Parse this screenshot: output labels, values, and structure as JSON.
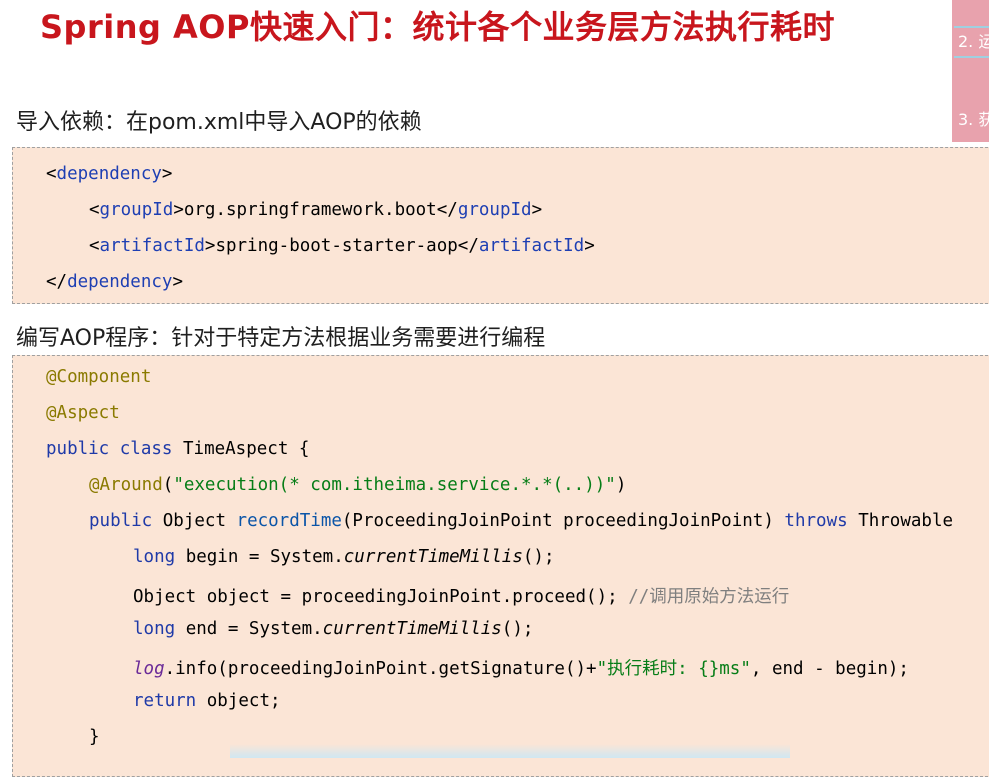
{
  "title": "Spring AOP快速入门：统计各个业务层方法执行耗时",
  "side_panel": {
    "item2": "2. 运",
    "item3": "3. 获"
  },
  "section1": {
    "heading": "导入依赖：在pom.xml中导入AOP的依赖",
    "code": {
      "open_tag": "dependency",
      "group_tag": "groupId",
      "group_value": "org.springframework.boot",
      "artifact_tag": "artifactId",
      "artifact_value": "spring-boot-starter-aop"
    }
  },
  "section2": {
    "heading": "编写AOP程序：针对于特定方法根据业务需要进行编程",
    "code": {
      "anno1": "@Component",
      "anno2": "@Aspect",
      "kw_public": "public",
      "kw_class": "class",
      "class_name": "TimeAspect {",
      "around_anno": "@Around",
      "around_arg": "\"execution(* com.itheima.service.*.*(..))\"",
      "method_sig_type": "Object",
      "method_name": "recordTime",
      "method_params": "(ProceedingJoinPoint proceedingJoinPoint)",
      "kw_throws": "throws",
      "throws_type": "Throwable",
      "kw_long": "long",
      "begin_stmt": "begin = System.",
      "current_millis": "currentTimeMillis",
      "call_end": "();",
      "proceed_stmt": "Object object = proceedingJoinPoint.proceed();",
      "proceed_comment": "//调用原始方法运行",
      "end_stmt": "end = System.",
      "log_var": "log",
      "log_call": ".info(proceedingJoinPoint.getSignature()+",
      "log_msg": "\"执行耗时: {}ms\"",
      "log_tail": ", end - begin);",
      "kw_return": "return",
      "return_value": "object;",
      "close_brace": "}"
    }
  }
}
